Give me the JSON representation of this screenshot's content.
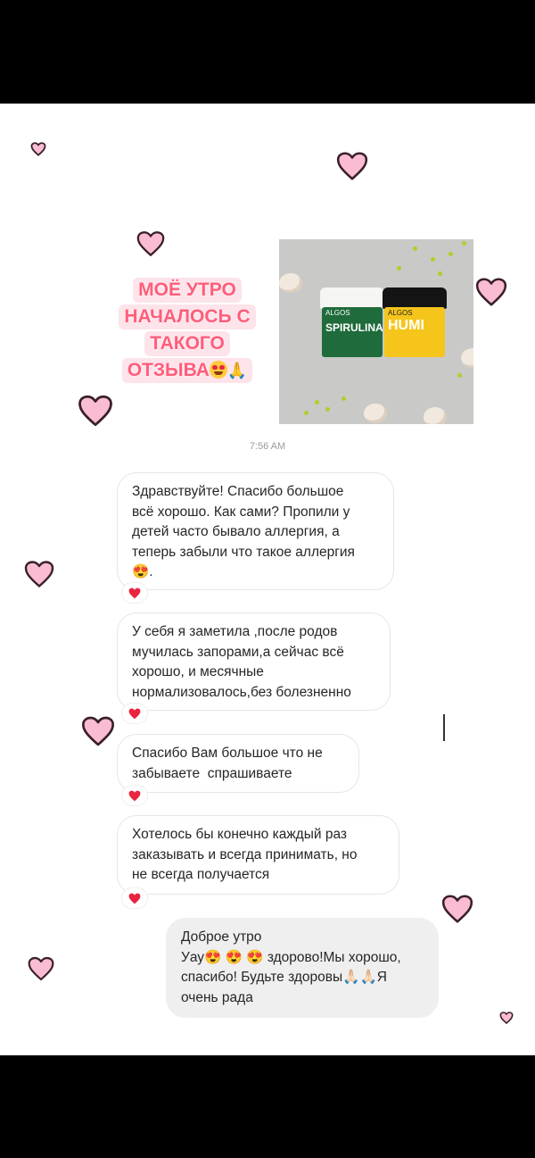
{
  "promo": {
    "lines": [
      "МОЁ УТРО",
      "НАЧАЛОСЬ С",
      "ТАКОГО",
      "ОТЗЫВА"
    ]
  },
  "product_photo": {
    "jar_left_label": "SPIRULINA",
    "jar_left_brand": "ALGOS",
    "jar_right_label": "HUMI",
    "jar_right_brand": "ALGOS"
  },
  "chat": {
    "timestamp": "7:56 AM",
    "messages": [
      {
        "text": "Здравствуйте! Спасибо большое\nвсё хорошо. Как сами? Пропили у\nдетей часто бывало аллергия, а\nтеперь забыли что такое аллергия\n😍."
      },
      {
        "text": "У себя я заметила ,после родов\nмучилась запорами,а сейчас всё\nхорошо, и месячные\nнормализовалось,без болезненно"
      },
      {
        "text": "Спасибо Вам большое что не\nзабываете  спрашиваете"
      },
      {
        "text": "Хотелось бы конечно каждый раз\nзаказывать и всегда принимать, но\nне всегда получается"
      },
      {
        "text": "Доброе утро\nУау😍 😍 😍 здорово!Мы хорошо,\nспасибо! Будьте здоровы🙏🏻🙏🏻Я\nочень рада"
      }
    ],
    "reaction_icon": "heart-reaction-icon"
  },
  "colors": {
    "heart_fill": "#f9bcd3",
    "heart_stroke": "#3a1f2a",
    "promo_text": "#ff5d7a",
    "reaction": "#e8253f"
  }
}
